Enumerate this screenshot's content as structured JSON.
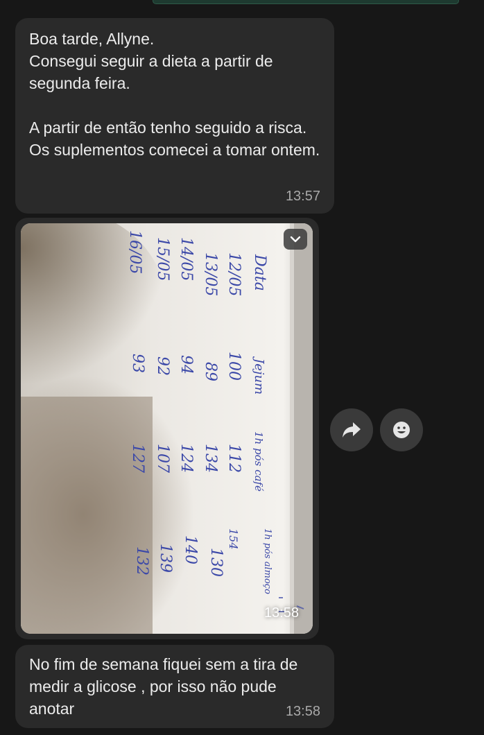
{
  "messages": [
    {
      "text": "Boa tarde, Allyne.\nConsegui seguir a dieta a partir de segunda feira.\n\nA partir de então tenho seguido a risca.\nOs suplementos comecei a tomar ontem.",
      "time": "13:57"
    },
    {
      "type": "image",
      "time": "13:58",
      "photo_text": {
        "header_date": "Data",
        "header_jejum": "Jejum",
        "header_cafe": "1h pós café",
        "header_almoco": "1h pós almoço",
        "rows": [
          {
            "date": "12/05",
            "jejum": "100",
            "cafe": "112",
            "almoco": "154"
          },
          {
            "date": "13/05",
            "jejum": "89",
            "cafe": "134",
            "almoco": "130"
          },
          {
            "date": "14/05",
            "jejum": "94",
            "cafe": "124",
            "almoco": "140"
          },
          {
            "date": "15/05",
            "jejum": "92",
            "cafe": "107",
            "almoco": "139"
          },
          {
            "date": "16/05",
            "jejum": "93",
            "cafe": "127",
            "almoco": "132"
          }
        ]
      }
    },
    {
      "text": "No fim de semana fiquei sem a tira de medir a glicose , por isso não pude anotar",
      "time": "13:58"
    }
  ],
  "actions": {
    "menu_icon": "chevron-down-icon",
    "forward_icon": "forward-arrow-icon",
    "react_icon": "smile-emoji-icon"
  },
  "colors": {
    "background": "#171717",
    "bubble": "#2a2a2a",
    "text": "#ececec",
    "timestamp": "#a9a9a9",
    "ink": "#3b48a8"
  }
}
